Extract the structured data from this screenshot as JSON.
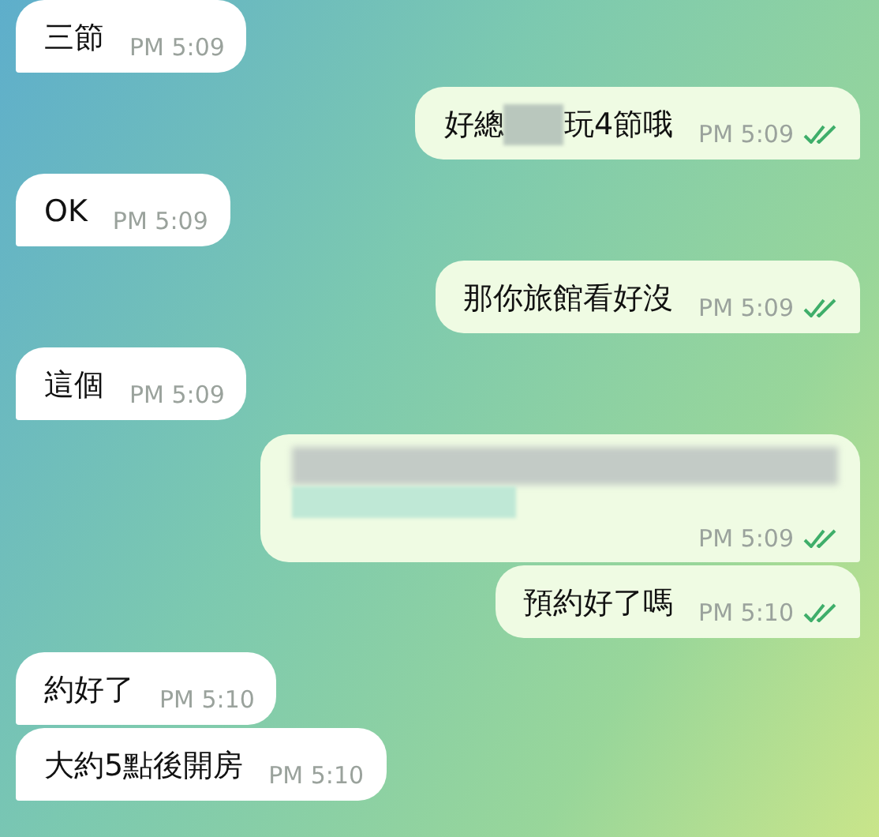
{
  "messages": [
    {
      "outgoing": false,
      "parts": [
        {
          "kind": "text",
          "text": "三節"
        }
      ],
      "time": "PM 5:09"
    },
    {
      "outgoing": true,
      "parts": [
        {
          "kind": "text",
          "text": "好總"
        },
        {
          "kind": "redacted"
        },
        {
          "kind": "text",
          "text": "玩4節哦"
        }
      ],
      "time": "PM 5:09",
      "read": true
    },
    {
      "outgoing": false,
      "parts": [
        {
          "kind": "text",
          "text": "OK"
        }
      ],
      "time": "PM 5:09"
    },
    {
      "outgoing": true,
      "parts": [
        {
          "kind": "text",
          "text": "那你旅館看好沒"
        }
      ],
      "time": "PM 5:09",
      "read": true
    },
    {
      "outgoing": false,
      "parts": [
        {
          "kind": "text",
          "text": "這個"
        }
      ],
      "time": "PM 5:09"
    },
    {
      "outgoing": true,
      "parts": [
        {
          "kind": "redacted_block"
        }
      ],
      "time": "PM 5:09",
      "read": true
    },
    {
      "outgoing": true,
      "parts": [
        {
          "kind": "text",
          "text": "預約好了嗎"
        }
      ],
      "time": "PM 5:10",
      "read": true
    },
    {
      "outgoing": false,
      "parts": [
        {
          "kind": "text",
          "text": "約好了"
        }
      ],
      "time": "PM 5:10"
    },
    {
      "outgoing": false,
      "parts": [
        {
          "kind": "text",
          "text": "大約5點後開房"
        }
      ],
      "time": "PM 5:10"
    }
  ]
}
